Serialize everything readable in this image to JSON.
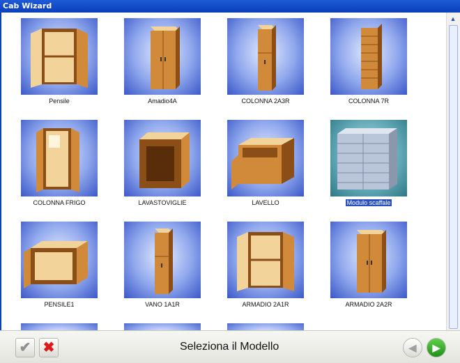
{
  "window": {
    "title": "Cab Wizard"
  },
  "models": [
    {
      "label": "Pensile",
      "shape": "open-two-door",
      "selected": false
    },
    {
      "label": "Amadio4A",
      "shape": "tall-two-door",
      "selected": false
    },
    {
      "label": "COLONNA 2A3R",
      "shape": "tall-narrow",
      "selected": false
    },
    {
      "label": "COLONNA 7R",
      "shape": "shelf-narrow",
      "selected": false
    },
    {
      "label": "COLONNA FRIGO",
      "shape": "tall-open",
      "selected": false
    },
    {
      "label": "LAVASTOVIGLIE",
      "shape": "open-box",
      "selected": false
    },
    {
      "label": "LAVELLO",
      "shape": "sink",
      "selected": false
    },
    {
      "label": "Modulo scaffale",
      "shape": "wide-shelf",
      "selected": true
    },
    {
      "label": "PENSILE1",
      "shape": "wide-open",
      "selected": false
    },
    {
      "label": "VANO 1A1R",
      "shape": "tall-narrow",
      "selected": false
    },
    {
      "label": "ARMADIO 2A1R",
      "shape": "open-two-door",
      "selected": false
    },
    {
      "label": "ARMADIO 2A2R",
      "shape": "tall-two-door",
      "selected": false
    }
  ],
  "footer": {
    "prompt": "Seleziona il Modello",
    "ok_glyph": "✔",
    "cancel_glyph": "✖",
    "back_glyph": "◀",
    "next_glyph": "▶"
  },
  "colors": {
    "wood": "#d08a3a",
    "wood_dark": "#8a4e16",
    "wood_light": "#f2d39a",
    "shelf": "#b9c6da"
  }
}
